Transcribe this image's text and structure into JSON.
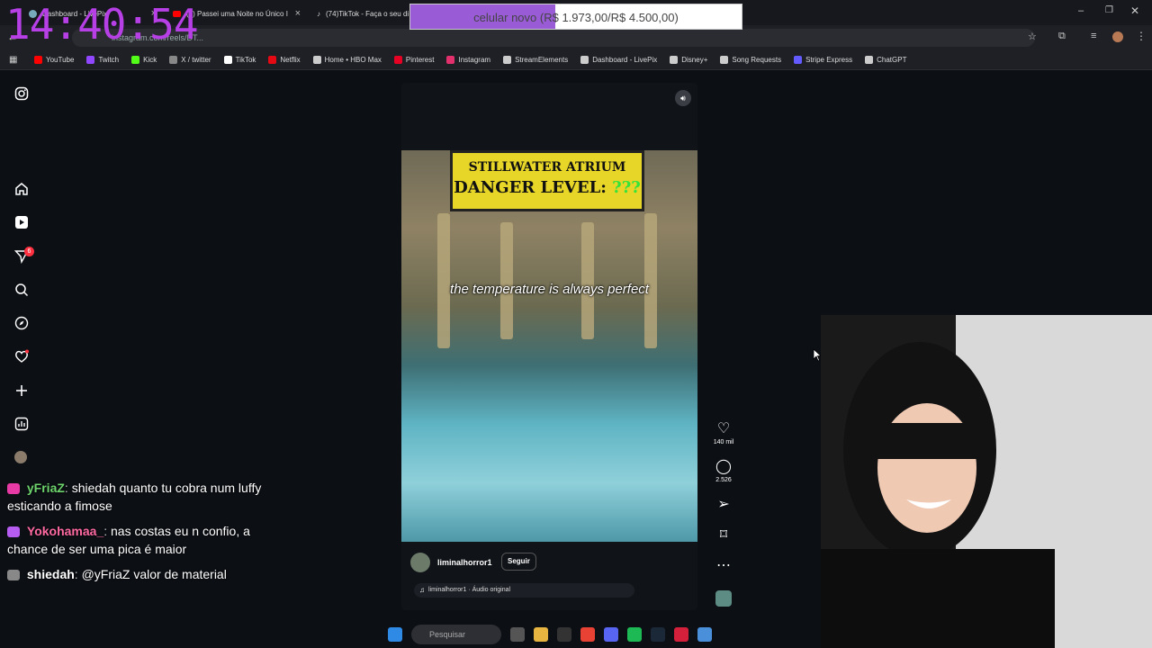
{
  "browser": {
    "tabs": [
      {
        "label": "Dashboard - LivePix"
      },
      {
        "label": "(1) Passei uma Noite no Único I"
      },
      {
        "label": "(74)TikTok - Faça o seu di"
      }
    ],
    "url": "instagram.com/reels/DT...",
    "bookmarks": [
      {
        "label": "YouTube",
        "color": "#ff0000"
      },
      {
        "label": "Twitch",
        "color": "#9146ff"
      },
      {
        "label": "Kick",
        "color": "#53fc18"
      },
      {
        "label": "X / twitter",
        "color": "#888888"
      },
      {
        "label": "TikTok",
        "color": "#ffffff"
      },
      {
        "label": "Netflix",
        "color": "#e50914"
      },
      {
        "label": "Home • HBO Max",
        "color": "#cccccc"
      },
      {
        "label": "Pinterest",
        "color": "#e60023"
      },
      {
        "label": "Instagram",
        "color": "#e1306c"
      },
      {
        "label": "StreamElements",
        "color": "#cccccc"
      },
      {
        "label": "Dashboard - LivePix",
        "color": "#cccccc"
      },
      {
        "label": "Disney+",
        "color": "#cccccc"
      },
      {
        "label": "Song Requests",
        "color": "#cccccc"
      },
      {
        "label": "Stripe Express",
        "color": "#635bff"
      },
      {
        "label": "ChatGPT",
        "color": "#cccccc"
      }
    ]
  },
  "overlay": {
    "clock": "14:40:54",
    "goal": {
      "text": "celular novo (R$ 1.973,00/R$ 4.500,00)",
      "progress": 0.438
    }
  },
  "sidebar": {
    "notifications_badge": "6"
  },
  "reel": {
    "sign_line1": "STILLWATER ATRIUM",
    "sign_line2": "DANGER LEVEL:",
    "sign_level": "???",
    "caption": "the temperature is always perfect",
    "username": "liminalhorror1",
    "follow_label": "Seguir",
    "audio": "liminalhorror1 · Áudio original"
  },
  "actions": {
    "likes": "140 mil",
    "comments": "2.526"
  },
  "chat": [
    {
      "user": "yFriaZ",
      "user_color": "#6dd36d",
      "text": "shiedah quanto tu cobra num luffy esticando a fimose"
    },
    {
      "user": "Yokohamaa_",
      "user_color": "#ff6aa2",
      "text": "nas costas eu n confio, a chance de ser uma pica é maior"
    },
    {
      "user": "shiedah",
      "user_color": "#ffffff",
      "text": "@yFriaZ valor de material"
    }
  ],
  "taskbar": {
    "search_placeholder": "Pesquisar"
  }
}
